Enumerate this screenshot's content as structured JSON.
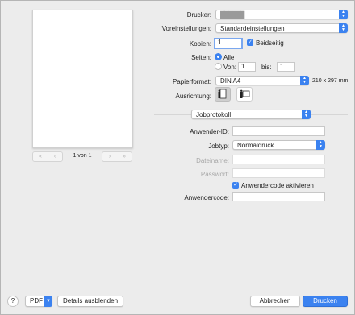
{
  "preview": {
    "page_label": "1 von 1",
    "first_icon": "double-chevron-left",
    "prev_icon": "chevron-left",
    "next_icon": "chevron-right",
    "last_icon": "double-chevron-right"
  },
  "printer": {
    "label": "Drucker:",
    "value": "████ ██"
  },
  "presets": {
    "label": "Voreinstellungen:",
    "value": "Standardeinstellungen"
  },
  "copies": {
    "label": "Kopien:",
    "value": "1",
    "duplex_label": "Beidseitig",
    "duplex_checked": true
  },
  "pages": {
    "label": "Seiten:",
    "all_label": "Alle",
    "from_label": "Von:",
    "from_value": "1",
    "to_label": "bis:",
    "to_value": "1",
    "selected": "all"
  },
  "paper": {
    "label": "Papierformat:",
    "value": "DIN A4",
    "dimensions": "210 x 297 mm"
  },
  "orientation": {
    "label": "Ausrichtung:",
    "selected": "portrait"
  },
  "section_popup": {
    "value": "Jobprotokoll"
  },
  "job": {
    "user_id_label": "Anwender-ID:",
    "user_id_value": "",
    "type_label": "Jobtyp:",
    "type_value": "Normaldruck",
    "filename_label": "Dateiname:",
    "filename_value": "",
    "password_label": "Passwort:",
    "password_value": "",
    "usercode_check_label": "Anwendercode aktivieren",
    "usercode_checked": true,
    "usercode_label": "Anwendercode:",
    "usercode_value": ""
  },
  "footer": {
    "help_label": "?",
    "pdf_label": "PDF",
    "details_label": "Details ausblenden",
    "cancel_label": "Abbrechen",
    "print_label": "Drucken"
  },
  "colors": {
    "accent": "#3b82f0",
    "background": "#ececec"
  }
}
